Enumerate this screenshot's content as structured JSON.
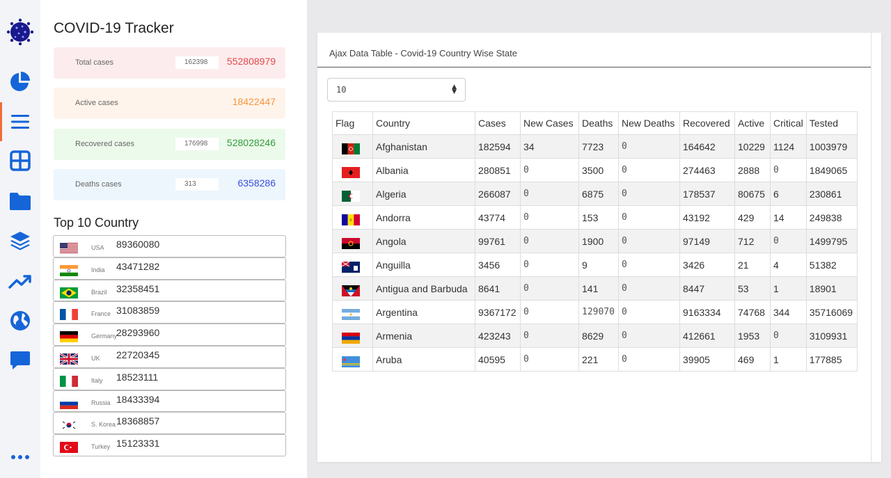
{
  "app": {
    "title": "COVID-19 Tracker"
  },
  "rail": {
    "icons": [
      "virus-logo",
      "pie-chart-icon",
      "menu-icon",
      "grid-icon",
      "folder-icon",
      "layers-icon",
      "trending-up-icon",
      "globe-icon",
      "chat-icon",
      "more-icon"
    ]
  },
  "stats": {
    "total": {
      "label": "Total cases",
      "new": "162398",
      "value": "552808979"
    },
    "active": {
      "label": "Active cases",
      "value": "18422447"
    },
    "recovered": {
      "label": "Recovered cases",
      "new": "176998",
      "value": "528028246"
    },
    "deaths": {
      "label": "Deaths cases",
      "new": "313",
      "value": "6358286"
    }
  },
  "top10": {
    "title": "Top 10 Country",
    "items": [
      {
        "name": "USA",
        "count": "89360080",
        "flag": "us"
      },
      {
        "name": "India",
        "count": "43471282",
        "flag": "in"
      },
      {
        "name": "Brazil",
        "count": "32358451",
        "flag": "br"
      },
      {
        "name": "France",
        "count": "31083859",
        "flag": "fr"
      },
      {
        "name": "Germany",
        "count": "28293960",
        "flag": "de"
      },
      {
        "name": "UK",
        "count": "22720345",
        "flag": "gb"
      },
      {
        "name": "Italy",
        "count": "18523111",
        "flag": "it"
      },
      {
        "name": "Russia",
        "count": "18433394",
        "flag": "ru"
      },
      {
        "name": "S. Korea",
        "count": "18368857",
        "flag": "kr"
      },
      {
        "name": "Turkey",
        "count": "15123331",
        "flag": "tr"
      }
    ]
  },
  "table": {
    "title": "Ajax Data Table - Covid-19 Country Wise State",
    "page_size": "10",
    "headers": [
      "Flag",
      "Country",
      "Cases",
      "New Cases",
      "Deaths",
      "New Deaths",
      "Recovered",
      "Active",
      "Critical",
      "Tested"
    ],
    "rows": [
      {
        "flag": "af",
        "country": "Afghanistan",
        "cases": "182594",
        "new_cases": "34",
        "deaths": "7723",
        "new_deaths": "0",
        "recovered": "164642",
        "active": "10229",
        "critical": "1124",
        "tested": "1003979"
      },
      {
        "flag": "al",
        "country": "Albania",
        "cases": "280851",
        "new_cases": "0",
        "deaths": "3500",
        "new_deaths": "0",
        "recovered": "274463",
        "active": "2888",
        "critical": "0",
        "tested": "1849065"
      },
      {
        "flag": "dz",
        "country": "Algeria",
        "cases": "266087",
        "new_cases": "0",
        "deaths": "6875",
        "new_deaths": "0",
        "recovered": "178537",
        "active": "80675",
        "critical": "6",
        "tested": "230861"
      },
      {
        "flag": "ad",
        "country": "Andorra",
        "cases": "43774",
        "new_cases": "0",
        "deaths": "153",
        "new_deaths": "0",
        "recovered": "43192",
        "active": "429",
        "critical": "14",
        "tested": "249838"
      },
      {
        "flag": "ao",
        "country": "Angola",
        "cases": "99761",
        "new_cases": "0",
        "deaths": "1900",
        "new_deaths": "0",
        "recovered": "97149",
        "active": "712",
        "critical": "0",
        "tested": "1499795"
      },
      {
        "flag": "ai",
        "country": "Anguilla",
        "cases": "3456",
        "new_cases": "0",
        "deaths": "9",
        "new_deaths": "0",
        "recovered": "3426",
        "active": "21",
        "critical": "4",
        "tested": "51382"
      },
      {
        "flag": "ag",
        "country": "Antigua and Barbuda",
        "cases": "8641",
        "new_cases": "0",
        "deaths": "141",
        "new_deaths": "0",
        "recovered": "8447",
        "active": "53",
        "critical": "1",
        "tested": "18901"
      },
      {
        "flag": "ar",
        "country": "Argentina",
        "cases": "9367172",
        "new_cases": "0",
        "deaths": "129070",
        "new_deaths": "0",
        "recovered": "9163334",
        "active": "74768",
        "critical": "344",
        "tested": "35716069"
      },
      {
        "flag": "am",
        "country": "Armenia",
        "cases": "423243",
        "new_cases": "0",
        "deaths": "8629",
        "new_deaths": "0",
        "recovered": "412661",
        "active": "1953",
        "critical": "0",
        "tested": "3109931"
      },
      {
        "flag": "aw",
        "country": "Aruba",
        "cases": "40595",
        "new_cases": "0",
        "deaths": "221",
        "new_deaths": "0",
        "recovered": "39905",
        "active": "469",
        "critical": "1",
        "tested": "177885"
      }
    ]
  },
  "colors": {
    "accent": "#1565d8",
    "active_bar": "#f26b3a"
  }
}
